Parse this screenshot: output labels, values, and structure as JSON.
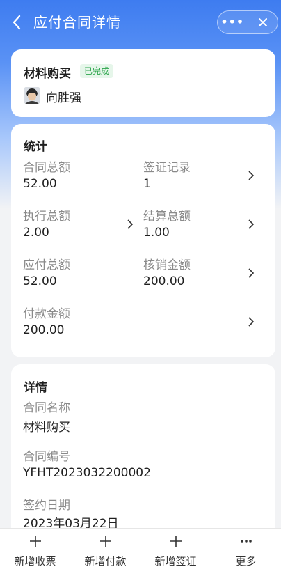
{
  "header": {
    "title": "应付合同详情"
  },
  "summary": {
    "contract_type": "材料购买",
    "status": "已完成",
    "person": "向胜强"
  },
  "stats": {
    "title": "统计",
    "items": [
      {
        "label": "合同总额",
        "value": "52.00"
      },
      {
        "label": "签证记录",
        "value": "1"
      },
      {
        "label": "执行总额",
        "value": "2.00"
      },
      {
        "label": "结算总额",
        "value": "1.00"
      },
      {
        "label": "应付总额",
        "value": "52.00"
      },
      {
        "label": "核销金额",
        "value": "200.00"
      },
      {
        "label": "付款金额",
        "value": "200.00"
      }
    ]
  },
  "details": {
    "title": "详情",
    "fields": [
      {
        "label": "合同名称",
        "value": "材料购买"
      },
      {
        "label": "合同编号",
        "value": "YFHT2023032200002"
      },
      {
        "label": "签约日期",
        "value": "2023年03月22日"
      }
    ]
  },
  "bottom_bar": {
    "items": [
      {
        "label": "新增收票",
        "icon": "plus-icon"
      },
      {
        "label": "新增付款",
        "icon": "plus-icon"
      },
      {
        "label": "新增签证",
        "icon": "plus-icon"
      },
      {
        "label": "更多",
        "icon": "more-dots-icon"
      }
    ]
  },
  "colors": {
    "header_blue": "#3e7cf0",
    "status_green": "#2ba44a",
    "status_bg": "#e6f6ea"
  }
}
